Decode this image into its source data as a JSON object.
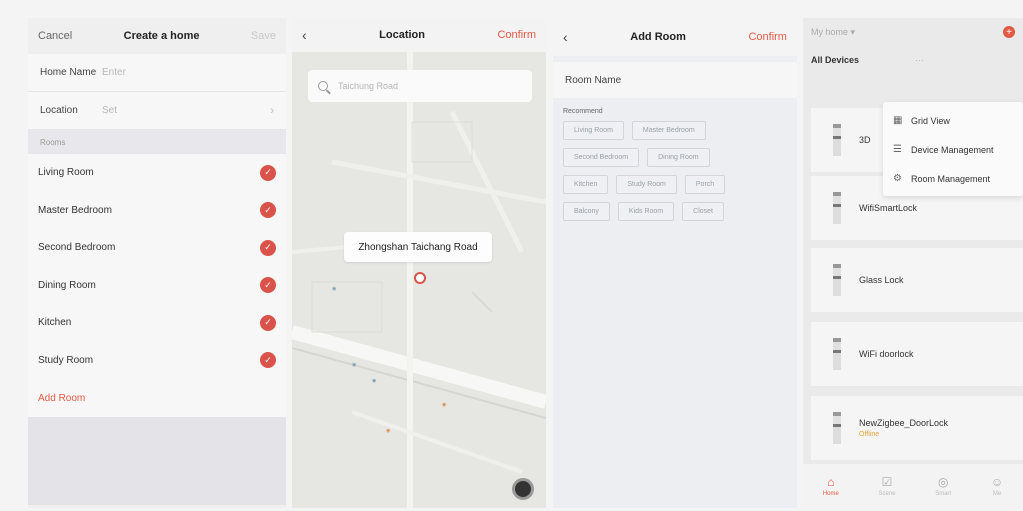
{
  "create_home": {
    "cancel_label": "Cancel",
    "title": "Create a home",
    "save_label": "Save",
    "home_name_label": "Home Name",
    "home_name_placeholder": "Enter",
    "location_label": "Location",
    "location_value": "Set",
    "rooms_section": "Rooms",
    "rooms": [
      "Living Room",
      "Master Bedroom",
      "Second Bedroom",
      "Dining Room",
      "Kitchen",
      "Study Room"
    ],
    "add_room_label": "Add Room"
  },
  "location": {
    "title": "Location",
    "confirm_label": "Confirm",
    "search_placeholder": "Taichung Road",
    "callout": "Zhongshan Taichang Road"
  },
  "add_room": {
    "title": "Add Room",
    "confirm_label": "Confirm",
    "room_name_label": "Room Name",
    "recommend_label": "Recommend",
    "recommend_chips": [
      [
        "Living Room",
        "Master Bedroom"
      ],
      [
        "Second Bedroom",
        "Dining Room"
      ],
      [
        "Kitchen",
        "Study Room",
        "Porch"
      ],
      [
        "Balcony",
        "Kids Room",
        "Closet"
      ]
    ]
  },
  "devices": {
    "home_selector": "My home",
    "tab_all": "All Devices",
    "tab_2": "",
    "tab_3": "",
    "tab_4": "",
    "menu": [
      "Grid View",
      "Device Management",
      "Room Management"
    ],
    "device_list": [
      {
        "name": "3D",
        "status": ""
      },
      {
        "name": "WifiSmartLock",
        "status": ""
      },
      {
        "name": "Glass Lock",
        "status": ""
      },
      {
        "name": "WiFi doorlock",
        "status": ""
      },
      {
        "name": "NewZigbee_DoorLock",
        "status": "Offline"
      }
    ],
    "nav": [
      "Home",
      "Scene",
      "Smart",
      "Me"
    ]
  }
}
